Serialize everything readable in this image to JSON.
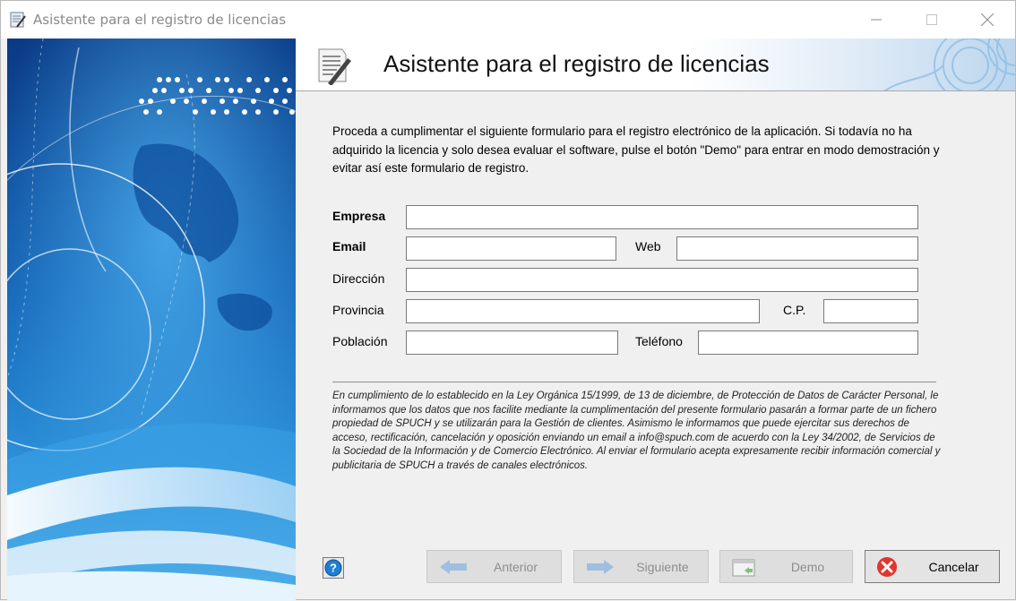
{
  "window": {
    "title": "Asistente para el registro de licencias",
    "controls": [
      "minimize",
      "maximize",
      "close"
    ]
  },
  "header": {
    "title": "Asistente para el registro de licencias",
    "icon": "document-pen-icon"
  },
  "intro": "Proceda a cumplimentar el siguiente formulario para el registro electrónico de la aplicación. Si todavía no ha adquirido la licencia y solo desea evaluar el software, pulse el botón \"Demo\" para entrar en modo demostración y evitar así este formulario de registro.",
  "form": {
    "empresa": {
      "label": "Empresa",
      "value": ""
    },
    "email": {
      "label": "Email",
      "value": ""
    },
    "web": {
      "label": "Web",
      "value": ""
    },
    "direccion": {
      "label": "Dirección",
      "value": ""
    },
    "provincia": {
      "label": "Provincia",
      "value": ""
    },
    "cp": {
      "label": "C.P.",
      "value": ""
    },
    "poblacion": {
      "label": "Población",
      "value": ""
    },
    "telefono": {
      "label": "Teléfono",
      "value": ""
    }
  },
  "legal": "En cumplimiento de lo establecido en la Ley Orgánica 15/1999, de 13 de diciembre, de Protección de Datos de Carácter Personal, le informamos que los datos que nos facilite mediante la cumplimentación del presente formulario pasarán a formar parte de un fichero propiedad de SPUCH y se utilizarán para la Gestión de clientes. Asimismo le informamos que puede ejercitar sus derechos de acceso, rectificación, cancelación y oposición enviando un email a info@spuch.com de acuerdo con la Ley 34/2002, de Servicios de la Sociedad de la Información y de Comercio Electrónico. Al enviar el formulario acepta expresamente recibir información comercial y publicitaria de SPUCH a través de canales electrónicos.",
  "buttons": {
    "help": {
      "icon": "help-icon"
    },
    "anterior": {
      "label": "Anterior",
      "enabled": false
    },
    "siguiente": {
      "label": "Siguiente",
      "enabled": false
    },
    "demo": {
      "label": "Demo",
      "enabled": false
    },
    "cancelar": {
      "label": "Cancelar",
      "enabled": true
    }
  },
  "colors": {
    "accent_blue": "#1f7fd0",
    "cancel_red": "#e0362b",
    "disabled_text": "#8d8d8d"
  }
}
